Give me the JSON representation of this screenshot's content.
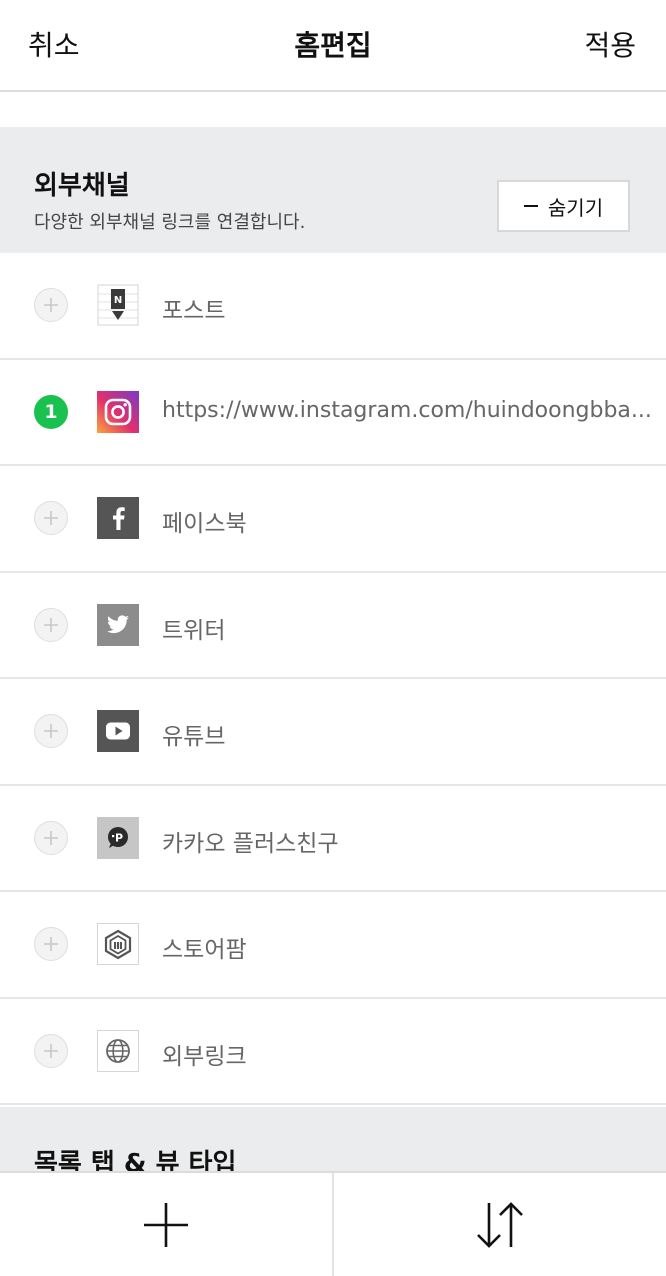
{
  "header": {
    "cancel_label": "취소",
    "title": "홈편집",
    "apply_label": "적용"
  },
  "section": {
    "title": "외부채널",
    "description": "다양한 외부채널 링크를 연결합니다.",
    "hide_label": "숨기기"
  },
  "channels": [
    {
      "label": "포스트",
      "icon": "naver-post-icon",
      "status": "add"
    },
    {
      "label": "https://www.instagram.com/huindoongbba...",
      "icon": "instagram-icon",
      "status": "1"
    },
    {
      "label": "페이스북",
      "icon": "facebook-icon",
      "status": "add"
    },
    {
      "label": "트위터",
      "icon": "twitter-icon",
      "status": "add"
    },
    {
      "label": "유튜브",
      "icon": "youtube-icon",
      "status": "add"
    },
    {
      "label": "카카오 플러스친구",
      "icon": "kakao-plus-friend-icon",
      "status": "add"
    },
    {
      "label": "스토어팜",
      "icon": "storefarm-icon",
      "status": "add"
    },
    {
      "label": "외부링크",
      "icon": "globe-icon",
      "status": "add"
    }
  ],
  "next_section": {
    "title": "목록 탭 & 뷰 타입"
  },
  "colors": {
    "active_badge": "#19c24f",
    "section_bg": "#ebecee",
    "label_gray": "#666666"
  }
}
